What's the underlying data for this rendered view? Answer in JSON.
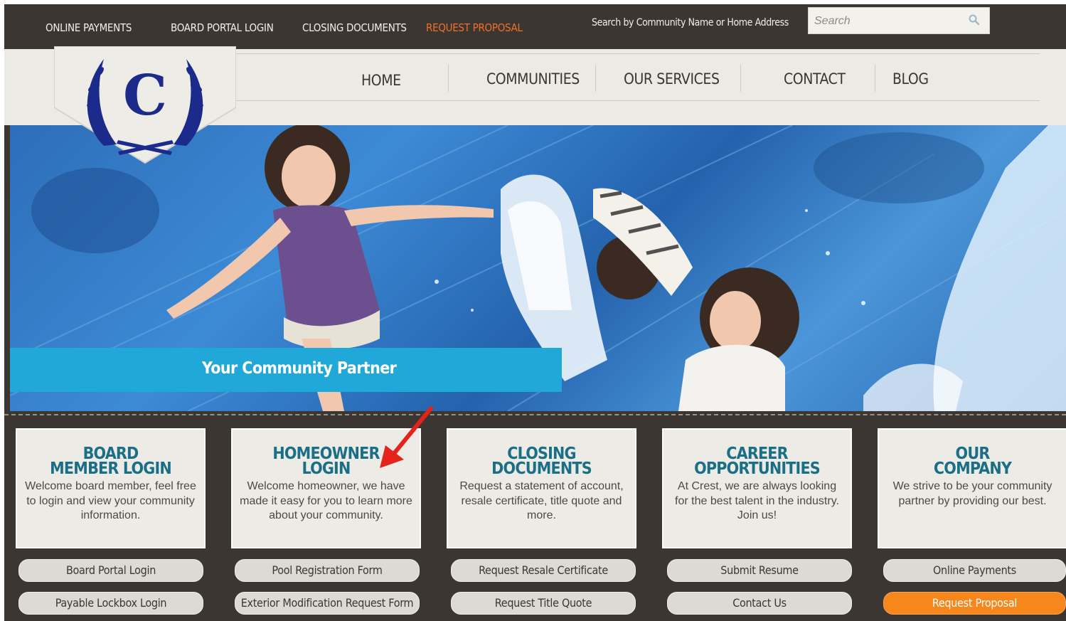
{
  "topnav": {
    "links": [
      "ONLINE PAYMENTS",
      "BOARD PORTAL LOGIN",
      "CLOSING DOCUMENTS",
      "REQUEST PROPOSAL"
    ],
    "search_label": "Search by Community Name or Home Address",
    "search_placeholder": "Search"
  },
  "logo": {
    "letter": "C"
  },
  "mainnav": {
    "items": [
      "HOME",
      "COMMUNITIES",
      "OUR SERVICES",
      "CONTACT",
      "BLOG"
    ]
  },
  "hero": {
    "tagline": "Your Community Partner"
  },
  "cards": [
    {
      "title_line1": "BOARD",
      "title_line2": "MEMBER LOGIN",
      "text": "Welcome board member, feel free to login and view your community information.",
      "buttons": [
        "Board Portal Login",
        "Payable Lockbox Login"
      ]
    },
    {
      "title_line1": "HOMEOWNER",
      "title_line2": "LOGIN",
      "text": "Welcome homeowner, we have made it easy for you to learn more about your community.",
      "buttons": [
        "Pool Registration Form",
        "Exterior Modification Request Form"
      ]
    },
    {
      "title_line1": "CLOSING",
      "title_line2": "DOCUMENTS",
      "text": "Request a statement of account, resale certificate, title quote and more.",
      "buttons": [
        "Request Resale Certificate",
        "Request Title Quote"
      ]
    },
    {
      "title_line1": "CAREER",
      "title_line2": "OPPORTUNITIES",
      "text": "At Crest, we are always looking for the best talent in the industry. Join us!",
      "buttons": [
        "Submit Resume",
        "Contact Us"
      ]
    },
    {
      "title_line1": "OUR",
      "title_line2": "COMPANY",
      "text": "We strive to be your community partner by providing our best.",
      "buttons": [
        "Online Payments",
        "Request Proposal"
      ]
    }
  ],
  "colors": {
    "dark_bar": "#3b3631",
    "accent_orange": "#f26f2a",
    "card_title_teal": "#1a6f86",
    "tagline_blue": "#1fa8d8",
    "logo_navy": "#1c2a8c",
    "annotation_arrow": "#e3231c"
  }
}
